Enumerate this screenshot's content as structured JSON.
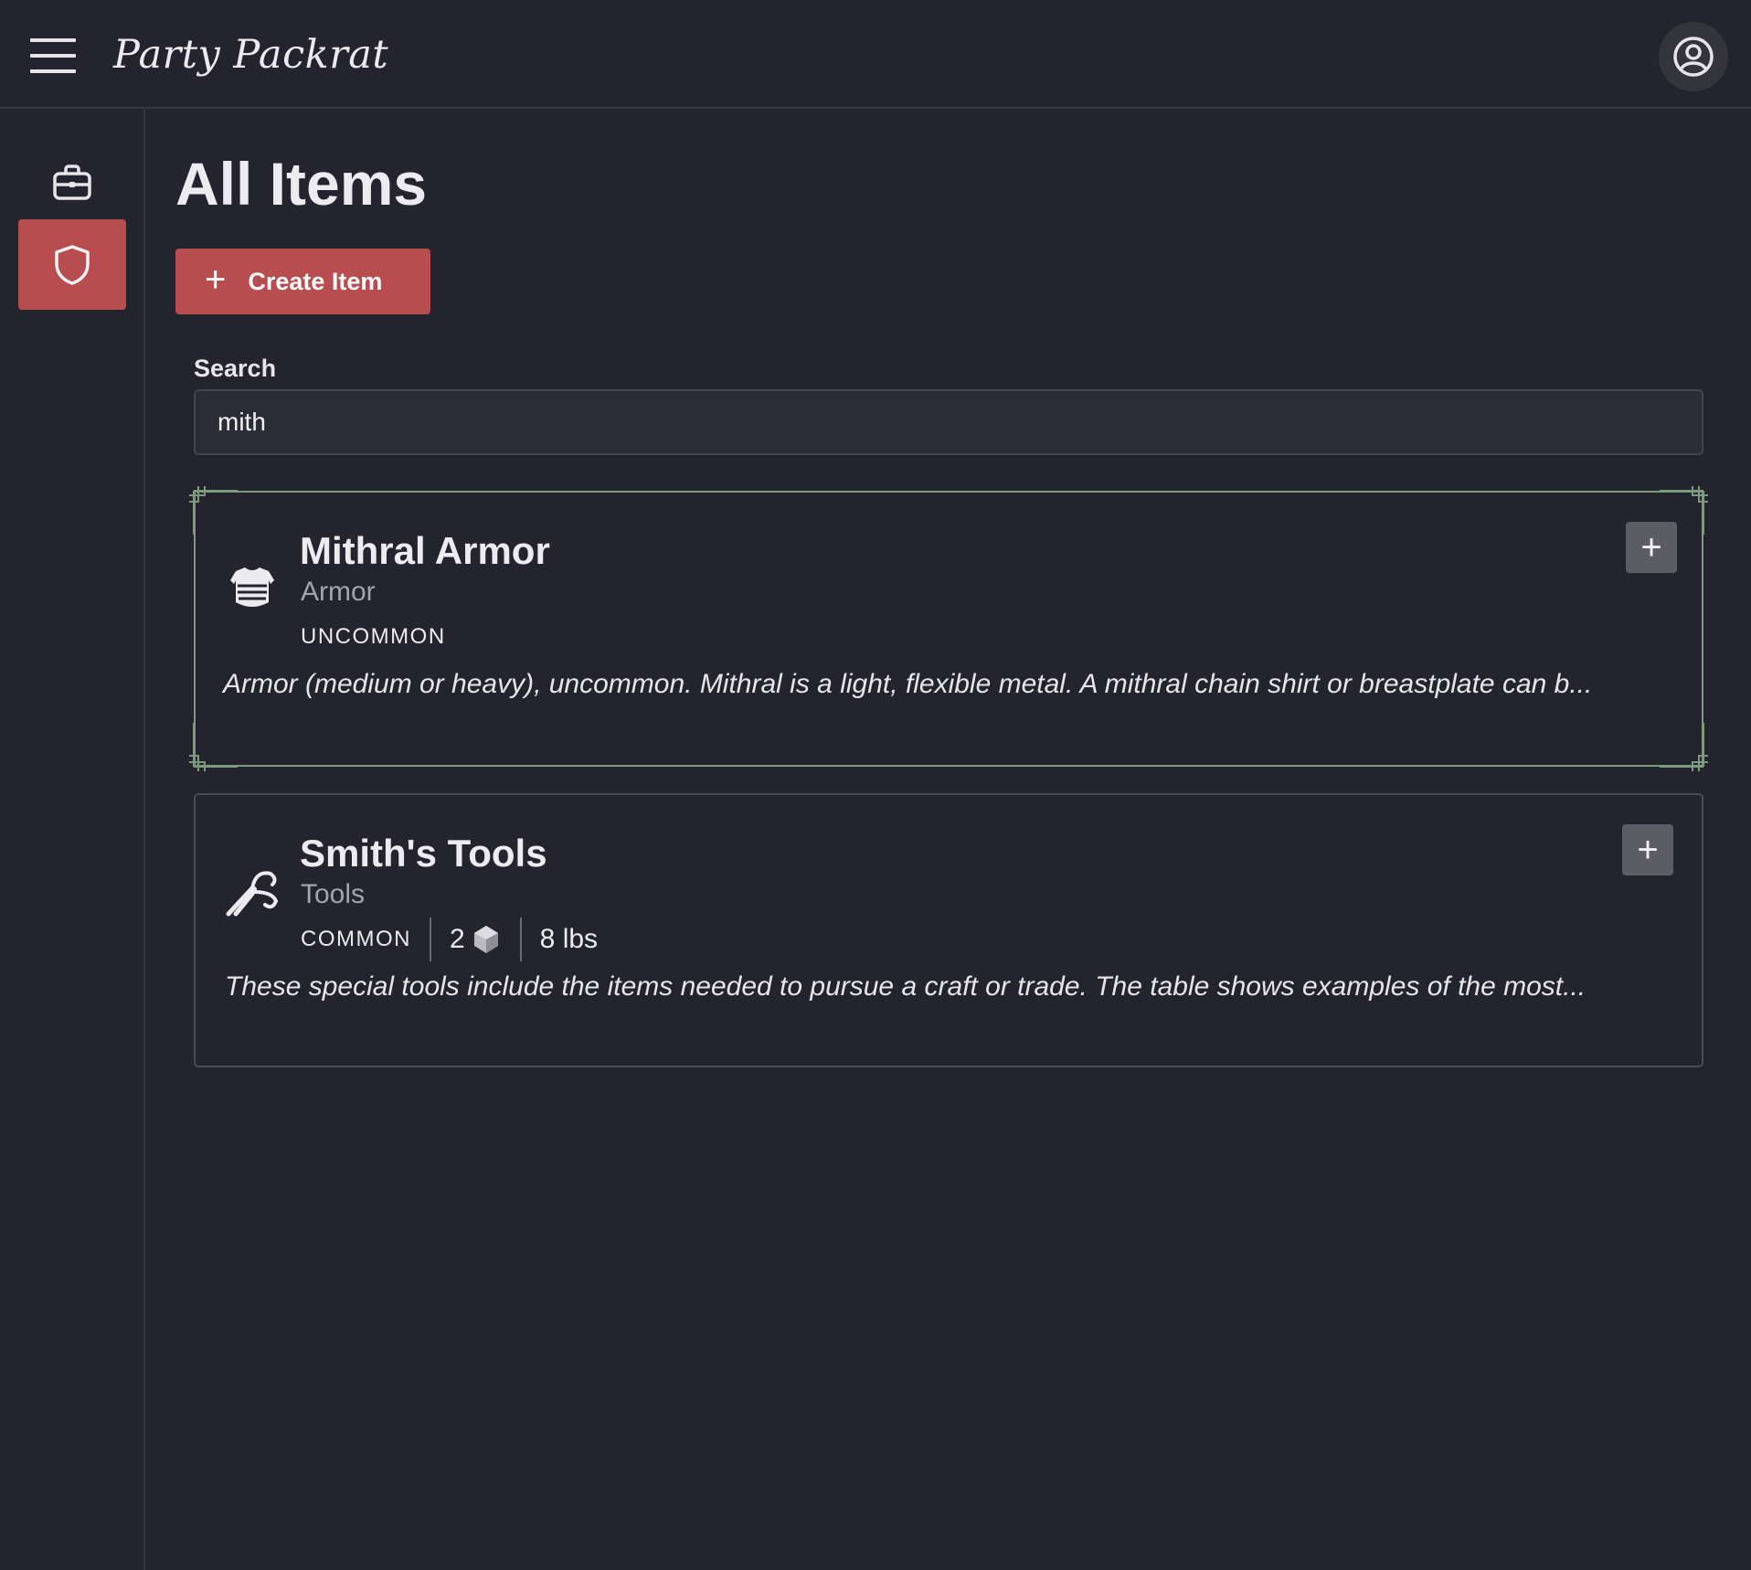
{
  "app": {
    "title": "Party Packrat"
  },
  "header": {
    "menu_icon": "hamburger-icon",
    "account_icon": "user-circle-icon"
  },
  "sidebar": {
    "items": [
      {
        "icon": "briefcase-icon",
        "active": false
      },
      {
        "icon": "shield-icon",
        "active": true
      }
    ]
  },
  "main": {
    "title": "All Items",
    "create_button": {
      "label": "Create Item",
      "icon": "plus-icon"
    },
    "search": {
      "label": "Search",
      "value": "mith"
    }
  },
  "items": [
    {
      "name": "Mithral Armor",
      "type": "Armor",
      "rarity": "UNCOMMON",
      "icon": "breastplate-icon",
      "highlighted": true,
      "description": "Armor (medium or heavy), uncommon. Mithral is a light, flexible metal. A mithral chain shirt or breastplate can b..."
    },
    {
      "name": "Smith's Tools",
      "type": "Tools",
      "rarity": "COMMON",
      "icon": "tongs-icon",
      "cost": "2",
      "cost_icon": "gold-coin-icon",
      "weight": "8 lbs",
      "highlighted": false,
      "description": "These special tools include the items needed to pursue a craft or trade. The table shows examples of the most..."
    }
  ],
  "colors": {
    "accent": "#b74d4f",
    "background": "#23242d",
    "highlight_border": "#7d9a7e"
  }
}
